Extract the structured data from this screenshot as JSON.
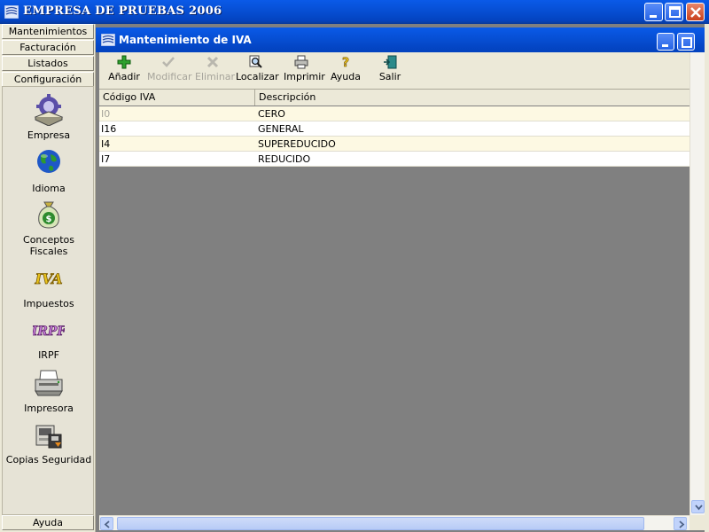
{
  "window": {
    "title": "EMPRESA DE PRUEBAS 2006"
  },
  "sidebar": {
    "nav": [
      {
        "label": "Mantenimientos"
      },
      {
        "label": "Facturación"
      },
      {
        "label": "Listados"
      },
      {
        "label": "Configuración"
      }
    ],
    "tools": [
      {
        "label": "Empresa",
        "icon": "company-gear-icon"
      },
      {
        "label": "Idioma",
        "icon": "globe-icon"
      },
      {
        "label": "Conceptos Fiscales",
        "icon": "money-bag-icon"
      },
      {
        "label": "Impuestos",
        "icon": "iva-icon",
        "icon_text": "IVA"
      },
      {
        "label": "IRPF",
        "icon": "irpf-icon",
        "icon_text": "IRPF"
      },
      {
        "label": "Impresora",
        "icon": "printer-icon"
      },
      {
        "label": "Copias Seguridad",
        "icon": "backup-icon"
      }
    ],
    "help_label": "Ayuda"
  },
  "child": {
    "title": "Mantenimiento de IVA",
    "toolbar": {
      "add": "Añadir",
      "modify": "Modificar",
      "delete": "Eliminar",
      "find": "Localizar",
      "print": "Imprimir",
      "help": "Ayuda",
      "exit": "Salir"
    },
    "table": {
      "columns": [
        "Código IVA",
        "Descripción"
      ],
      "rows": [
        [
          "I0",
          "CERO"
        ],
        [
          "I16",
          "GENERAL"
        ],
        [
          "I4",
          "SUPEREDUCIDO"
        ],
        [
          "I7",
          "REDUCIDO"
        ]
      ]
    }
  },
  "colors": {
    "title_bar": "#0750d6",
    "row_highlight": "#fdf9e3",
    "grid_background": "#808080"
  }
}
